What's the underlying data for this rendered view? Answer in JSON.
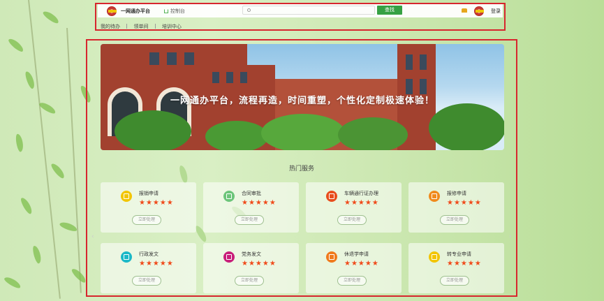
{
  "header": {
    "app_title": "一网通办平台",
    "home_link": "控制台",
    "search_placeholder": "",
    "search_button": "查找",
    "login": "登录"
  },
  "nav": [
    "我的待办",
    "领单间",
    "培训中心"
  ],
  "banner": {
    "slogan": "一网通办平台，流程再造，时间重塑，个性化定制极速体验！"
  },
  "section_title": "热门服务",
  "services": [
    {
      "name": "报销申请",
      "icon": "receipt-icon",
      "color": "#f2c500",
      "stars": "★★★★★",
      "action": "立即处理"
    },
    {
      "name": "合同审批",
      "icon": "contract-icon",
      "color": "#6cc57a",
      "stars": "★★★★★",
      "action": "立即处理"
    },
    {
      "name": "车辆通行证办理",
      "icon": "car-pass-icon",
      "color": "#e84d1c",
      "stars": "★★★★★",
      "action": "立即处理"
    },
    {
      "name": "报修申请",
      "icon": "wrench-icon",
      "color": "#f08a1c",
      "stars": "★★★★★",
      "action": "立即处理"
    },
    {
      "name": "行政发文",
      "icon": "document-icon",
      "color": "#1bb8c7",
      "stars": "★★★★★",
      "action": "立即处理"
    },
    {
      "name": "党务发文",
      "icon": "party-doc-icon",
      "color": "#c81e7a",
      "stars": "★★★★★",
      "action": "立即处理"
    },
    {
      "name": "休退学申请",
      "icon": "person-icon",
      "color": "#f07a1c",
      "stars": "★★★★★",
      "action": "立即处理"
    },
    {
      "name": "转专业申请",
      "icon": "chat-icon",
      "color": "#f2c500",
      "stars": "★★★★★",
      "action": "立即处理"
    }
  ]
}
